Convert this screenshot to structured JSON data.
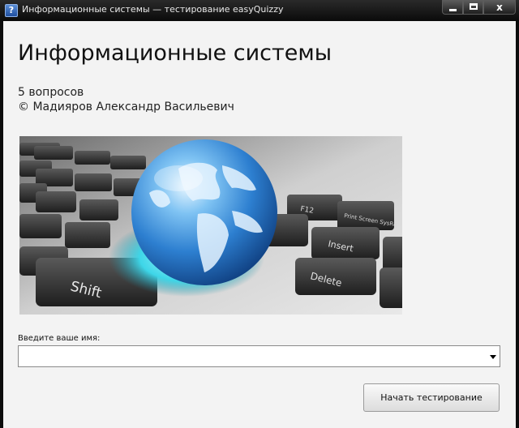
{
  "window": {
    "title": "Информационные системы — тестирование easyQuizzy",
    "app_icon_glyph": "?",
    "close_glyph": "x"
  },
  "quiz": {
    "title": "Информационные системы",
    "question_count": "5 вопросов",
    "author": "© Мадияров Александр Васильевич"
  },
  "banner": {
    "key_labels": [
      "Shift",
      "Insert",
      "Delete",
      "F12",
      "Print Screen SysRq"
    ]
  },
  "form": {
    "name_label": "Введите ваше имя:",
    "name_value": "",
    "start_button": "Начать тестирование"
  },
  "colors": {
    "title_bar": "#0c0c0c",
    "client_background": "#f3f3f3",
    "globe": "#2d7fd0"
  },
  "icons": [
    "question-app-icon",
    "minimize-icon",
    "maximize-icon",
    "close-icon",
    "chevron-down-icon"
  ]
}
